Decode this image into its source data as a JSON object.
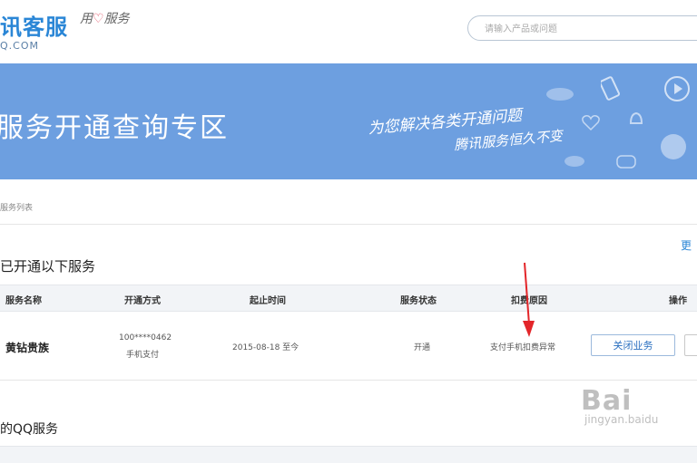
{
  "header": {
    "logo_text": "讯客服",
    "logo_domain": "Q.COM",
    "slogan_prefix": "用",
    "slogan_suffix": "服务",
    "search": {
      "placeholder": "请输入产品或问题"
    }
  },
  "banner": {
    "title": "服务开通查询专区",
    "slogan_line1": "为您解决各类开通问题",
    "slogan_line2": "腾讯服务恒久不变"
  },
  "breadcrumb": "服务列表",
  "section1": {
    "title": "已开通以下服务",
    "more_link": "更"
  },
  "table": {
    "headers": [
      "服务名称",
      "开通方式",
      "起止时间",
      "服务状态",
      "扣费原因",
      "操作"
    ],
    "rows": [
      {
        "name": "黄钻贵族",
        "method_account": "100****0462",
        "method_type": "手机支付",
        "period": "2015-08-18 至今",
        "status": "开通",
        "reason": "支付手机扣费异常",
        "action": "关闭业务"
      }
    ]
  },
  "section2": {
    "title": "的QQ服务"
  },
  "watermark": {
    "main": "Bai",
    "sub": "jingyan.baidu"
  },
  "colors": {
    "accent": "#2a86d6",
    "banner": "#6d9fe0",
    "arrow": "#e3262a",
    "table_header_bg": "#f2f4f7"
  }
}
